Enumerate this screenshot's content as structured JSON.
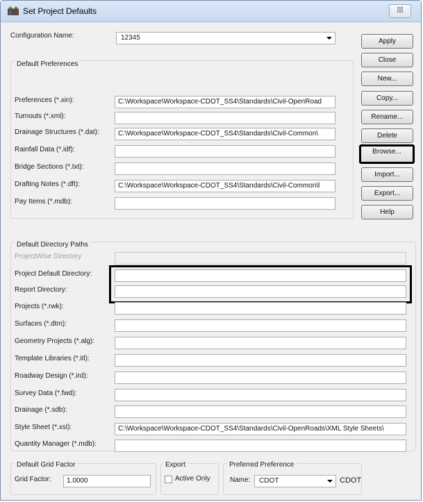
{
  "window": {
    "title": "Set Project Defaults",
    "close_glyph": "☒"
  },
  "config": {
    "label": "Configuration Name:",
    "value": "12345"
  },
  "buttons": {
    "apply": "Apply",
    "close": "Close",
    "new": "New...",
    "copy": "Copy...",
    "rename": "Rename...",
    "delete": "Delete",
    "browse": "Browse...",
    "import": "Import...",
    "export": "Export...",
    "help": "Help"
  },
  "default_preferences": {
    "title": "Default Preferences",
    "rows": [
      {
        "label": "Preferences (*.xin):",
        "value": "C:\\Workspace\\Workspace-CDOT_SS4\\Standards\\Civil-OpenRoad"
      },
      {
        "label": "Turnouts (*.xml):",
        "value": ""
      },
      {
        "label": "Drainage Structures (*.dat):",
        "value": "C:\\Workspace\\Workspace-CDOT_SS4\\Standards\\Civil-Common\\"
      },
      {
        "label": "Rainfall Data (*.idf):",
        "value": ""
      },
      {
        "label": "Bridge Sections (*.txt):",
        "value": ""
      },
      {
        "label": "Drafting Notes (*.dft):",
        "value": "C:\\Workspace\\Workspace-CDOT_SS4\\Standards\\Civil-Common\\l"
      },
      {
        "label": "Pay Items (*.mdb):",
        "value": ""
      }
    ]
  },
  "default_directory_paths": {
    "title": "Default Directory Paths",
    "projectwise_label": "ProjectWise Directory",
    "rows": [
      {
        "label": "Project Default Directory:",
        "value": ""
      },
      {
        "label": "Report Directory:",
        "value": ""
      },
      {
        "label": "Projects (*.rwk):",
        "value": ""
      },
      {
        "label": "Surfaces (*.dtm):",
        "value": ""
      },
      {
        "label": "Geometry Projects (*.alg):",
        "value": ""
      },
      {
        "label": "Template Libraries (*.itl):",
        "value": ""
      },
      {
        "label": "Roadway Design (*.ird):",
        "value": ""
      },
      {
        "label": "Survey Data (*.fwd):",
        "value": ""
      },
      {
        "label": "Drainage (*.sdb):",
        "value": ""
      },
      {
        "label": "Style Sheet (*.xsl):",
        "value": "C:\\Workspace\\Workspace-CDOT_SS4\\Standards\\Civil-OpenRoads\\XML Style Sheets\\"
      },
      {
        "label": "Quantity Manager (*.mdb):",
        "value": ""
      }
    ]
  },
  "grid_factor": {
    "title": "Default Grid Factor",
    "label": "Grid Factor:",
    "value": "1.0000"
  },
  "export": {
    "title": "Export",
    "active_only_label": "Active Only",
    "active_only_checked": false
  },
  "preferred": {
    "title": "Preferred Preference",
    "name_label": "Name:",
    "value": "CDOT",
    "current": "CDOT"
  }
}
